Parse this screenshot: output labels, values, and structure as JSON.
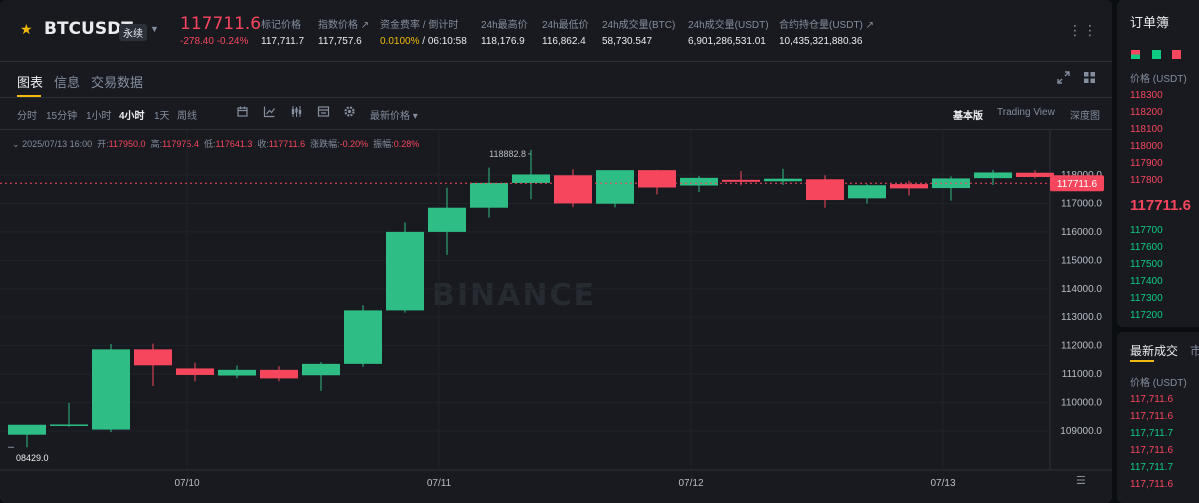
{
  "header": {
    "symbol": "BTCUSDT",
    "contract_badge": "永续",
    "last_price": "117711.6",
    "change": "-278.40  -0.24%",
    "stats": [
      {
        "label": "标记价格",
        "value": "117,711.7"
      },
      {
        "label": "指数价格 ↗",
        "value": "117,757.6"
      },
      {
        "label": "资金费率 / 倒计时",
        "value_rate": "0.0100%",
        "value_sep": " / ",
        "value_countdown": "06:10:58"
      },
      {
        "label": "24h最高价",
        "value": "118,176.9"
      },
      {
        "label": "24h最低价",
        "value": "116,862.4"
      },
      {
        "label": "24h成交量(BTC)",
        "value": "58,730.547"
      },
      {
        "label": "24h成交量(USDT)",
        "value": "6,901,286,531.01"
      },
      {
        "label": "合约持仓量(USDT) ↗",
        "value": "10,435,321,880.36"
      }
    ],
    "more_icon": "⋮⋮"
  },
  "tabs": [
    "图表",
    "信息",
    "交易数据"
  ],
  "toolbar": {
    "intervals": [
      "分时",
      "15分钟",
      "1小时",
      "4小时",
      "1天",
      "周线"
    ],
    "active_interval": "4小时",
    "price_type": "最新价格 ▾",
    "views": [
      "基本版",
      "Trading View",
      "深度图"
    ],
    "active_view": "基本版"
  },
  "ohlc": {
    "time": "2025/07/13 16:00",
    "open_label": "开:",
    "open": "117950.0",
    "high_label": "高:",
    "high": "117975.4",
    "low_label": "低:",
    "low": "117641.3",
    "close_label": "收:",
    "close": "117711.6",
    "chg_label": "涨跌幅:",
    "chg": "-0.20%",
    "amp_label": "振幅:",
    "amp": "0.28%"
  },
  "chart_data": {
    "type": "candlestick",
    "x_labels": [
      "07/10",
      "07/11",
      "07/12",
      "07/13"
    ],
    "y_ticks": [
      109000,
      110000,
      111000,
      112000,
      113000,
      114000,
      115000,
      116000,
      117000,
      118000
    ],
    "ylim": [
      108000,
      119000
    ],
    "current_price_label": "117711.6",
    "high_marker": "118882.8",
    "low_marker": "08429.0",
    "watermark": "BINANCE",
    "candles": [
      {
        "o": 108870,
        "h": 109050,
        "l": 108429,
        "c": 109220
      },
      {
        "o": 109220,
        "h": 109990,
        "l": 109150,
        "c": 109230
      },
      {
        "o": 109050,
        "h": 112060,
        "l": 108960,
        "c": 111870
      },
      {
        "o": 111870,
        "h": 112070,
        "l": 110580,
        "c": 111310
      },
      {
        "o": 111200,
        "h": 111400,
        "l": 110750,
        "c": 110970
      },
      {
        "o": 110950,
        "h": 111300,
        "l": 110860,
        "c": 111150
      },
      {
        "o": 111150,
        "h": 111280,
        "l": 110750,
        "c": 110850
      },
      {
        "o": 110960,
        "h": 111420,
        "l": 110410,
        "c": 111360
      },
      {
        "o": 111360,
        "h": 113420,
        "l": 111260,
        "c": 113240
      },
      {
        "o": 113240,
        "h": 116330,
        "l": 113160,
        "c": 116000
      },
      {
        "o": 116000,
        "h": 117550,
        "l": 115190,
        "c": 116850
      },
      {
        "o": 116850,
        "h": 118260,
        "l": 116500,
        "c": 117720
      },
      {
        "o": 117720,
        "h": 118883,
        "l": 117150,
        "c": 118020
      },
      {
        "o": 117990,
        "h": 118200,
        "l": 116870,
        "c": 117000
      },
      {
        "o": 116990,
        "h": 118140,
        "l": 116860,
        "c": 118170
      },
      {
        "o": 118170,
        "h": 118180,
        "l": 117320,
        "c": 117560
      },
      {
        "o": 117630,
        "h": 117970,
        "l": 117400,
        "c": 117900
      },
      {
        "o": 117830,
        "h": 118140,
        "l": 117640,
        "c": 117760
      },
      {
        "o": 117780,
        "h": 118220,
        "l": 117650,
        "c": 117870
      },
      {
        "o": 117850,
        "h": 117990,
        "l": 116850,
        "c": 117120
      },
      {
        "o": 117180,
        "h": 117680,
        "l": 117000,
        "c": 117640
      },
      {
        "o": 117680,
        "h": 117800,
        "l": 117280,
        "c": 117530
      },
      {
        "o": 117540,
        "h": 117950,
        "l": 117100,
        "c": 117880
      },
      {
        "o": 117890,
        "h": 118180,
        "l": 117650,
        "c": 118090
      },
      {
        "o": 118080,
        "h": 118170,
        "l": 117880,
        "c": 117930
      },
      {
        "o": 117950,
        "h": 117975,
        "l": 117641,
        "c": 117712
      }
    ]
  },
  "orderbook": {
    "title": "订单簿",
    "col_price": "价格 (USDT)",
    "asks": [
      "118300",
      "118200",
      "118100",
      "118000",
      "117900",
      "117800"
    ],
    "mid": "117711.6",
    "bids": [
      "117700",
      "117600",
      "117500",
      "117400",
      "117300",
      "117200"
    ]
  },
  "trades": {
    "title": "最新成交",
    "title2": "市",
    "col_price": "价格 (USDT)",
    "rows": [
      {
        "price": "117,711.6",
        "side": "red"
      },
      {
        "price": "117,711.6",
        "side": "red"
      },
      {
        "price": "117,711.7",
        "side": "green"
      },
      {
        "price": "117,711.6",
        "side": "red"
      },
      {
        "price": "117,711.7",
        "side": "green"
      },
      {
        "price": "117,711.6",
        "side": "red"
      }
    ]
  },
  "colors": {
    "up": "#2ebd85",
    "down": "#f6465d",
    "accent": "#f0b90b"
  }
}
